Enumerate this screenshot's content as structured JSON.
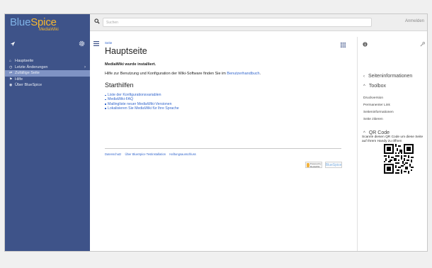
{
  "header": {
    "logo_main_blue": "Blue",
    "logo_main_spice": "Spice",
    "logo_sub": "MediaWiki",
    "search_placeholder": "Suchen",
    "login_label": "Anmelden"
  },
  "sidebar": {
    "items": [
      {
        "label": "Hauptseite",
        "icon": "home-icon"
      },
      {
        "label": "Letzte Änderungen",
        "icon": "clock-icon"
      },
      {
        "label": "Zufällige Seite",
        "icon": "shuffle-icon"
      },
      {
        "label": "Hilfe",
        "icon": "help-icon"
      },
      {
        "label": "Über BlueSpice",
        "icon": "info-icon"
      }
    ]
  },
  "main": {
    "breadcrumb": "Seite",
    "title": "Hauptseite",
    "installed_text": "MediaWiki wurde installiert.",
    "help_text_before": "Hilfe zur Benutzung und Konfiguration der Wiki-Software finden Sie im ",
    "help_link": "Benutzerhandbuch",
    "help_text_after": ".",
    "section_title": "Starthilfen",
    "links": [
      "Liste der Konfigurationsvariablen",
      "MediaWiki-FAQ",
      "Mailingliste neuer MediaWiki-Versionen",
      "Lokalisieren Sie MediaWiki für Ihre Sprache"
    ],
    "footer_links": [
      "Datenschutz",
      "Über BlueSpice Testinstallation",
      "Haftungsausschluss"
    ],
    "badge_mediawiki": "Powered by MediaWiki",
    "badge_bluespice": "BlueSpice"
  },
  "right_panel": {
    "page_info_heading": "Seiteninformationen",
    "toolbox_heading": "Toolbox",
    "toolbox_items": [
      "Druckversion",
      "Permanenter Link",
      "Seiteninformationen",
      "Seite zitieren"
    ],
    "qr_heading": "QR Code",
    "qr_text": "Scanne diesen QR Code um diese Seite auf Ihrem Handy zu öffnen"
  },
  "colors": {
    "sidebar_bg": "#3e5389",
    "sidebar_active": "#7f93c4",
    "link": "#3366cc",
    "logo_blue": "#7fb2e6",
    "logo_orange": "#f6b830"
  }
}
